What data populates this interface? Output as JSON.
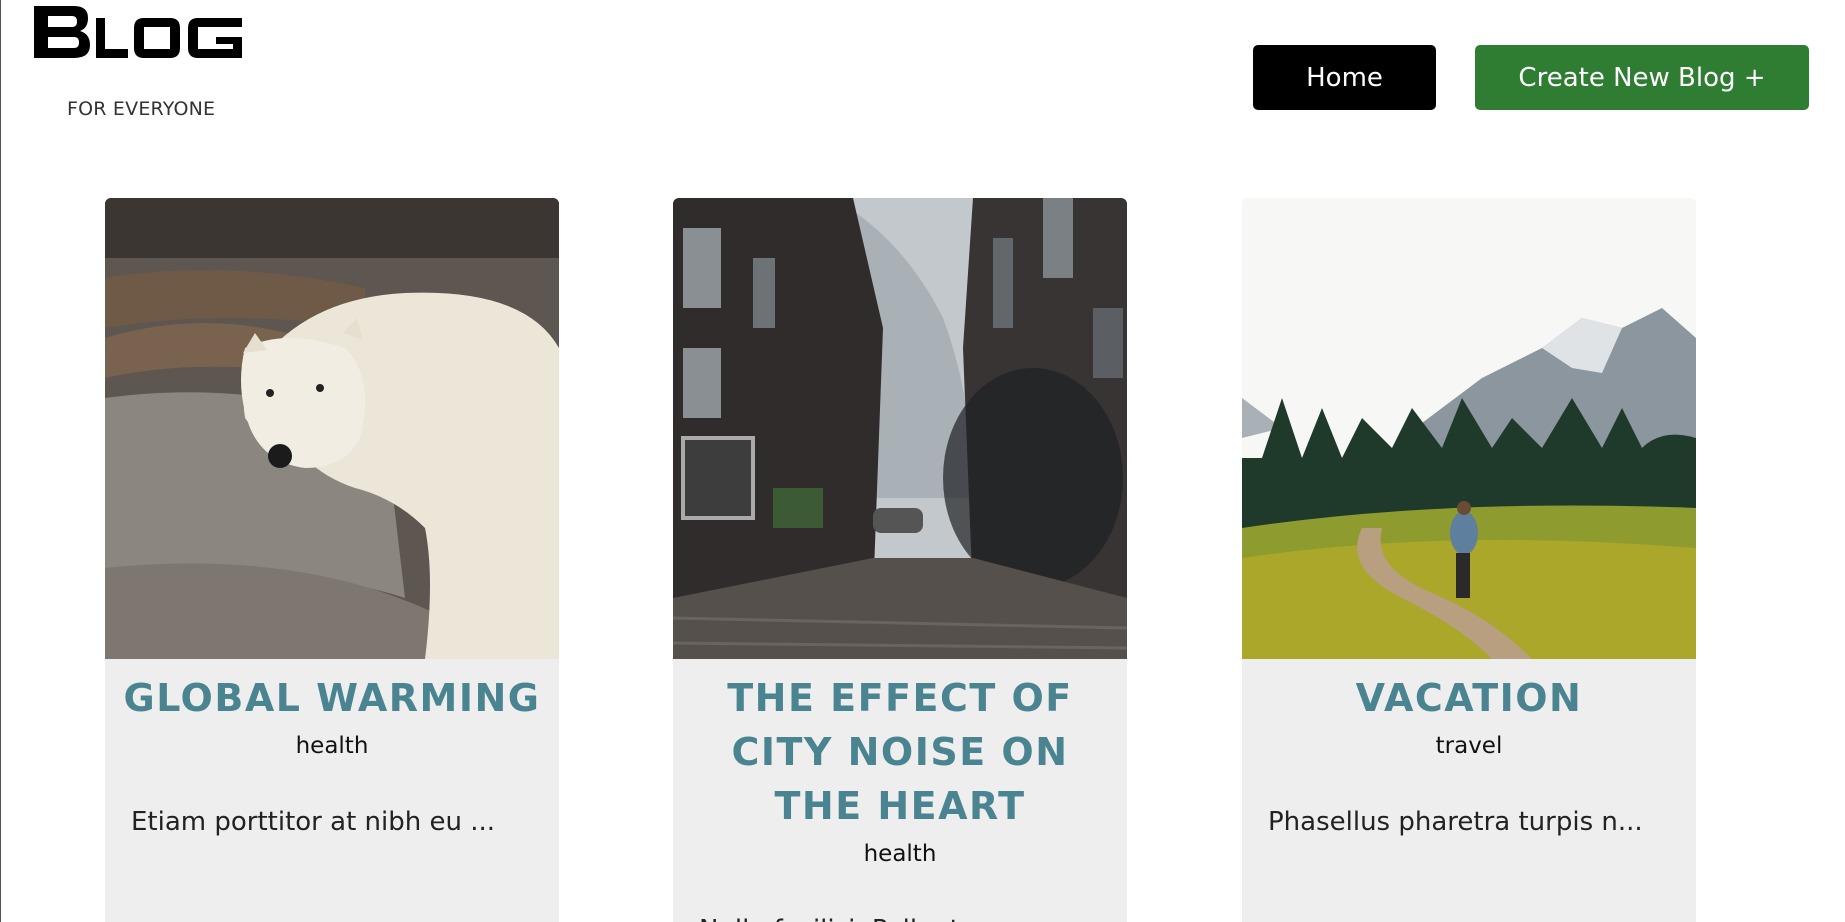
{
  "header": {
    "logo_text": "BLOG",
    "tagline": "FOR EVERYONE"
  },
  "nav": {
    "home_label": "Home",
    "create_label": "Create New Blog +"
  },
  "colors": {
    "home_bg": "#000000",
    "create_bg": "#2e7d32",
    "title_color": "#4a8491",
    "card_bg": "#eeeeee"
  },
  "posts": [
    {
      "title": "GLOBAL WARMING",
      "category": "health",
      "excerpt": "Etiam porttitor at nibh eu ...",
      "image": "polar-bear-photo"
    },
    {
      "title": "THE EFFECT OF CITY NOISE ON THE HEART",
      "category": "health",
      "excerpt": "Nulla facilisi. Pellentesqu...",
      "image": "city-street-photo"
    },
    {
      "title": "VACATION",
      "category": "travel",
      "excerpt": "Phasellus pharetra turpis n...",
      "image": "mountain-hiker-photo"
    }
  ]
}
